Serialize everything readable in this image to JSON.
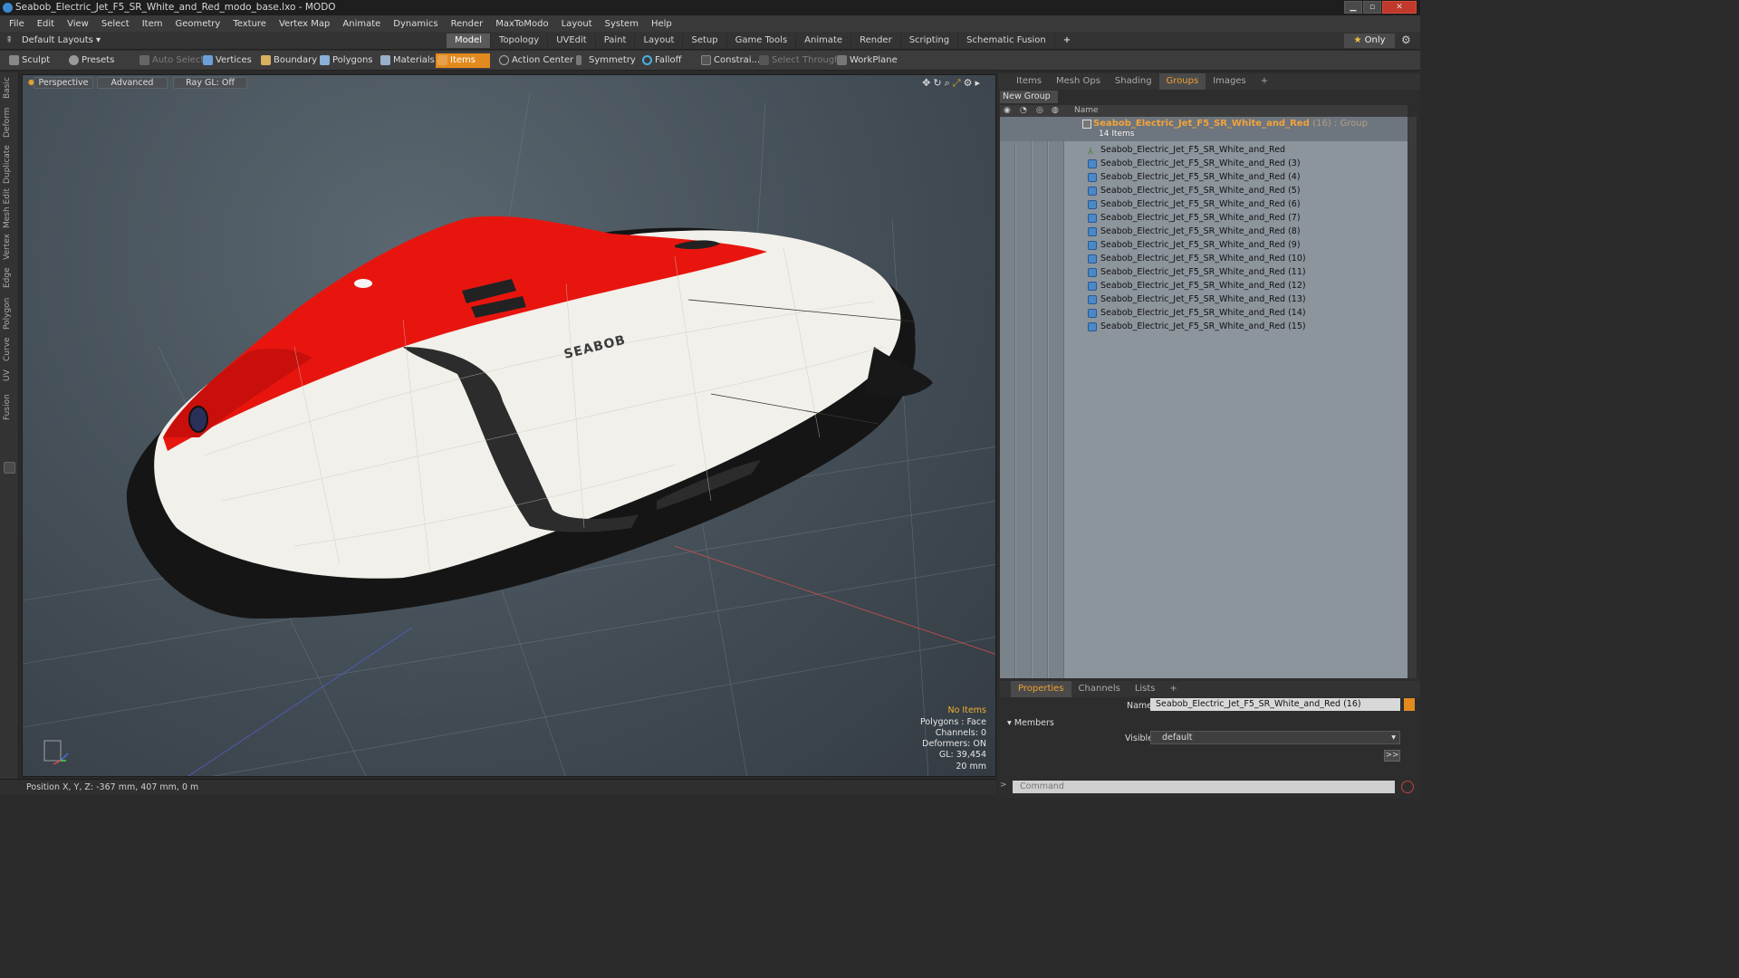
{
  "window": {
    "title": "Seabob_Electric_Jet_F5_SR_White_and_Red_modo_base.lxo - MODO"
  },
  "menu": [
    "File",
    "Edit",
    "View",
    "Select",
    "Item",
    "Geometry",
    "Texture",
    "Vertex Map",
    "Animate",
    "Dynamics",
    "Render",
    "MaxToModo",
    "Layout",
    "System",
    "Help"
  ],
  "layout_selector": "Default Layouts",
  "mode_tabs": [
    "Model",
    "Topology",
    "UVEdit",
    "Paint",
    "Layout",
    "Setup",
    "Game Tools",
    "Animate",
    "Render",
    "Scripting",
    "Schematic Fusion"
  ],
  "mode_add": "+",
  "only_label": "Only",
  "toolbar": {
    "sculpt": "Sculpt",
    "presets": "Presets",
    "auto_select": "Auto Select",
    "vertices": "Vertices",
    "boundary": "Boundary",
    "polygons": "Polygons",
    "materials": "Materials",
    "items": "Items",
    "action_center": "Action Center",
    "symmetry": "Symmetry",
    "falloff": "Falloff",
    "constraints": "Constrai...",
    "select_through": "Select Through",
    "workplane": "WorkPlane"
  },
  "left_tabs": [
    "Basic",
    "Deform",
    "Duplicate",
    "Mesh Edit",
    "Vertex",
    "Edge",
    "Polygon",
    "Curve",
    "UV",
    "Fusion"
  ],
  "viewport": {
    "perspective": "Perspective",
    "advanced": "Advanced",
    "raygl": "Ray GL: Off",
    "brand_text": "SEABOB",
    "info": {
      "items": "No Items",
      "polygons": "Polygons : Face",
      "channels": "Channels: 0",
      "deformers": "Deformers: ON",
      "gl": "GL: 39,454",
      "scale": "20 mm"
    }
  },
  "status": {
    "position": "Position X, Y, Z:  -367 mm, 407 mm, 0 m"
  },
  "right_tabs": [
    "Items",
    "Mesh Ops",
    "Shading",
    "Groups",
    "Images"
  ],
  "right_add": "+",
  "new_group": "New Group",
  "list_header": {
    "name": "Name"
  },
  "group": {
    "name": "Seabob_Electric_Jet_F5_SR_White_and_Red",
    "suffix": "(16) : Group",
    "count": "14 Items"
  },
  "items": [
    "Seabob_Electric_Jet_F5_SR_White_and_Red",
    "Seabob_Electric_Jet_F5_SR_White_and_Red (3)",
    "Seabob_Electric_Jet_F5_SR_White_and_Red (4)",
    "Seabob_Electric_Jet_F5_SR_White_and_Red (5)",
    "Seabob_Electric_Jet_F5_SR_White_and_Red (6)",
    "Seabob_Electric_Jet_F5_SR_White_and_Red (7)",
    "Seabob_Electric_Jet_F5_SR_White_and_Red (8)",
    "Seabob_Electric_Jet_F5_SR_White_and_Red (9)",
    "Seabob_Electric_Jet_F5_SR_White_and_Red (10)",
    "Seabob_Electric_Jet_F5_SR_White_and_Red (11)",
    "Seabob_Electric_Jet_F5_SR_White_and_Red (12)",
    "Seabob_Electric_Jet_F5_SR_White_and_Red (13)",
    "Seabob_Electric_Jet_F5_SR_White_and_Red (14)",
    "Seabob_Electric_Jet_F5_SR_White_and_Red (15)"
  ],
  "prop_tabs": [
    "Properties",
    "Channels",
    "Lists"
  ],
  "prop_add": "+",
  "properties": {
    "name_label": "Name",
    "name_value": "Seabob_Electric_Jet_F5_SR_White_and_Red (16)",
    "members_label": "Members",
    "visible_label": "Visible",
    "visible_value": "default",
    "more": ">>"
  },
  "command": {
    "placeholder": "Command"
  },
  "colors": {
    "accent": "#e28a1e",
    "group_text": "#f2a33a",
    "hull_red": "#e8150f",
    "hull_white": "#f2f0ea",
    "hull_black": "#151515"
  }
}
